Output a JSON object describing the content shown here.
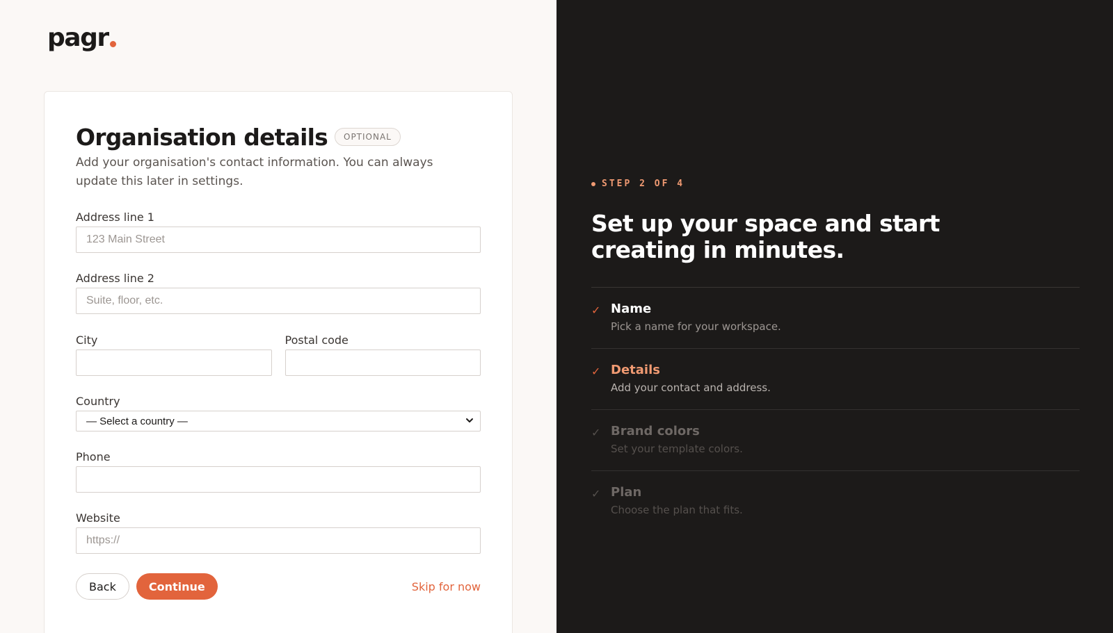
{
  "brand": {
    "name": "pagr",
    "accent_color": "#e2643c"
  },
  "form": {
    "title": "Organisation details",
    "badge": "OPTIONAL",
    "subtitle": "Add your organisation's contact information. You can always update this later in settings.",
    "fields": {
      "address1": {
        "label": "Address line 1",
        "value": "",
        "placeholder": "123 Main Street"
      },
      "address2": {
        "label": "Address line 2",
        "value": "",
        "placeholder": "Suite, floor, etc."
      },
      "city": {
        "label": "City",
        "value": "",
        "placeholder": ""
      },
      "postal": {
        "label": "Postal code",
        "value": "",
        "placeholder": ""
      },
      "country": {
        "label": "Country",
        "selected": "— Select a country —"
      },
      "phone": {
        "label": "Phone",
        "value": "",
        "placeholder": ""
      },
      "website": {
        "label": "Website",
        "value": "",
        "placeholder": "https://"
      }
    },
    "actions": {
      "back": "Back",
      "continue": "Continue",
      "skip": "Skip for now"
    }
  },
  "side": {
    "step_label": "STEP 2 OF 4",
    "headline": "Set up your space and start creating in minutes.",
    "steps": [
      {
        "name": "Name",
        "desc": "Pick a name for your workspace.",
        "state": "done"
      },
      {
        "name": "Details",
        "desc": "Add your contact and address.",
        "state": "active"
      },
      {
        "name": "Brand colors",
        "desc": "Set your template colors.",
        "state": "todo"
      },
      {
        "name": "Plan",
        "desc": "Choose the plan that fits.",
        "state": "todo"
      }
    ]
  }
}
